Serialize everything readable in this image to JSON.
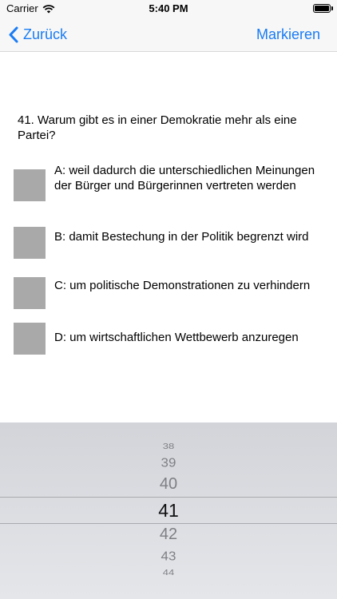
{
  "status_bar": {
    "carrier": "Carrier",
    "time": "5:40 PM",
    "icons": [
      "wifi-icon",
      "battery-icon"
    ]
  },
  "nav": {
    "back_label": "Zurück",
    "mark_label": "Markieren",
    "accent_color": "#1a7cf5"
  },
  "question": {
    "text": "41. Warum gibt es in einer Demokratie mehr als eine Partei?"
  },
  "answers": [
    {
      "label": "A: weil dadurch die unterschiedlichen Meinungen der Bürger und Bürgerinnen vertreten werden"
    },
    {
      "label": "B: damit Bestechung in der Politik begrenzt wird"
    },
    {
      "label": "C: um politische Demonstrationen zu verhindern"
    },
    {
      "label": "D: um wirtschaftlichen Wettbewerb anzuregen"
    }
  ],
  "picker": {
    "items": [
      "38",
      "39",
      "40",
      "41",
      "42",
      "43",
      "44"
    ],
    "selected": "41"
  }
}
